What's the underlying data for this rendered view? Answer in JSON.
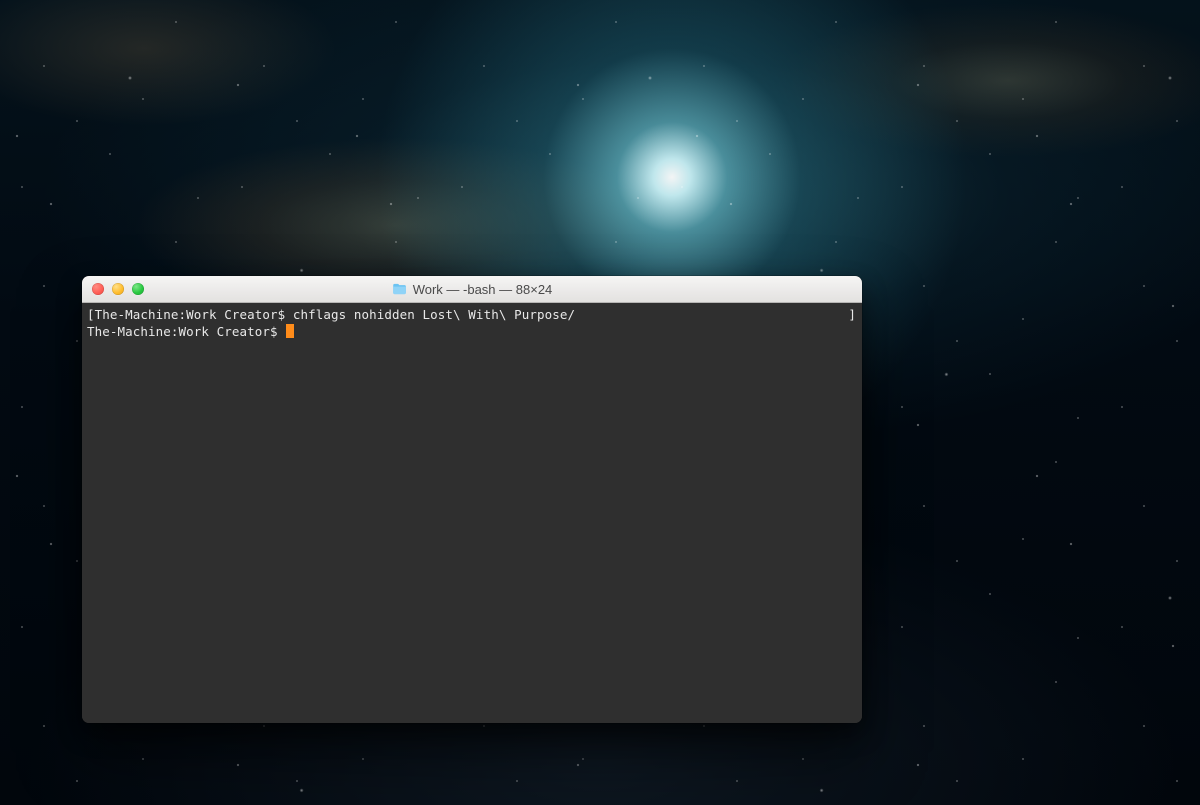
{
  "window": {
    "title": "Work — -bash — 88×24",
    "folder_name": "Work"
  },
  "terminal": {
    "lines": [
      {
        "left_bracket": "[",
        "prompt": "The-Machine:Work Creator$ ",
        "command": "chflags nohidden Lost\\ With\\ Purpose/",
        "right_bracket": "]"
      },
      {
        "prompt": "The-Machine:Work Creator$ ",
        "command": "",
        "cursor": true
      }
    ],
    "cursor_color": "#ff8c1a",
    "background": "#2f2f2f",
    "text_color": "#e8e8e8"
  },
  "traffic_lights": {
    "close": "#ff5f57",
    "minimize": "#ffbd2e",
    "zoom": "#28c840"
  }
}
